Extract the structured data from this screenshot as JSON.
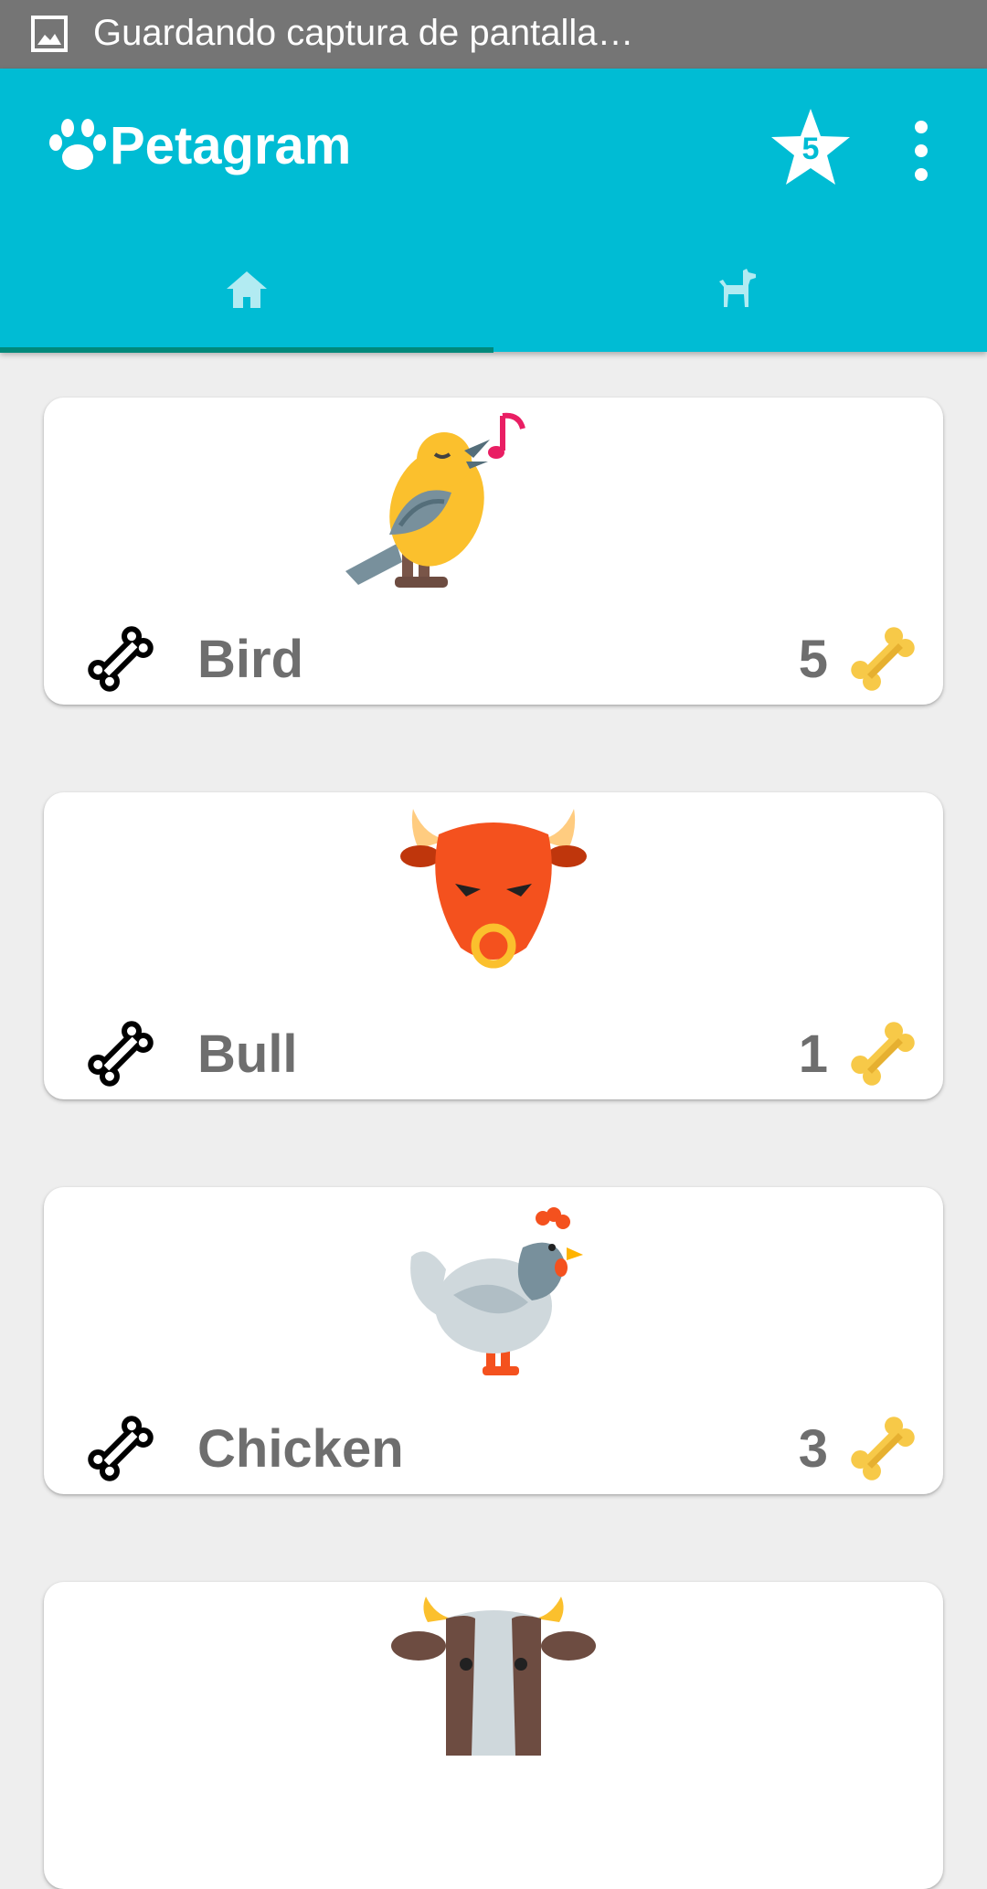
{
  "status_bar": {
    "text": "Guardando captura de pantalla…",
    "icon": "image-icon"
  },
  "app_bar": {
    "title": "Petagram",
    "logo_icon": "paw-icon",
    "favorites_badge": "5",
    "favorites_icon": "star-icon",
    "menu_icon": "more-vert-icon",
    "color": "#00bcd4"
  },
  "tabs": [
    {
      "icon": "home-icon",
      "selected": true
    },
    {
      "icon": "dog-icon",
      "selected": false
    }
  ],
  "pets": [
    {
      "name": "Bird",
      "likes": "5",
      "image": "singing-bird"
    },
    {
      "name": "Bull",
      "likes": "1",
      "image": "bull-head"
    },
    {
      "name": "Chicken",
      "likes": "3",
      "image": "chicken"
    },
    {
      "name": "",
      "likes": "",
      "image": "cow-head"
    }
  ],
  "colors": {
    "accent": "#00bcd4",
    "indicator": "#00897b",
    "bone_like": "#f7c948",
    "text": "#6e6e6e"
  }
}
